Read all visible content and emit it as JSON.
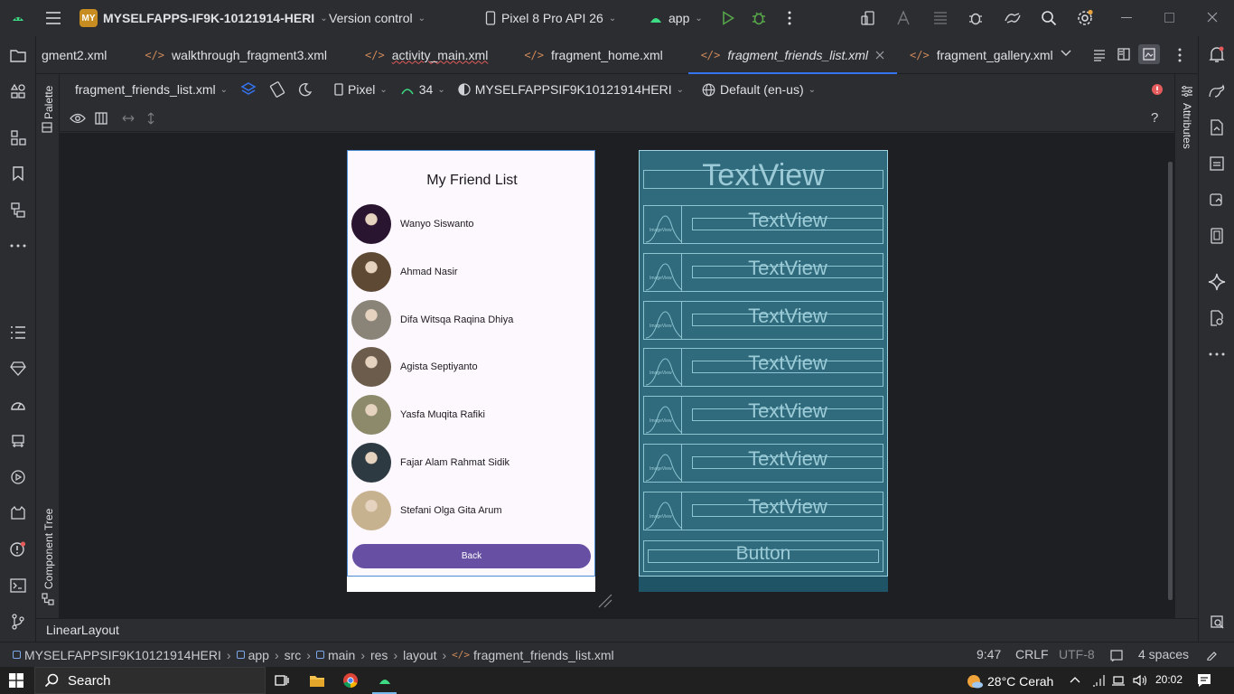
{
  "titlebar": {
    "project_badge": "MY",
    "project_name": "MYSELFAPPS-IF9K-10121914-HERI",
    "vcs": "Version control",
    "device": "Pixel 8 Pro API 26",
    "run_config": "app"
  },
  "tabs": [
    {
      "label": "gment2.xml"
    },
    {
      "label": "walkthrough_fragment3.xml"
    },
    {
      "label": "activity_main.xml"
    },
    {
      "label": "fragment_home.xml"
    },
    {
      "label": "fragment_friends_list.xml"
    },
    {
      "label": "fragment_gallery.xml"
    }
  ],
  "designbar": {
    "file": "fragment_friends_list.xml",
    "device": "Pixel",
    "api": "34",
    "theme": "MYSELFAPPSIF9K10121914HERI",
    "locale": "Default (en-us)"
  },
  "side_panels": {
    "palette": "Palette",
    "component_tree": "Component Tree",
    "attributes": "Attributes"
  },
  "phone": {
    "title": "My Friend List",
    "friends": [
      {
        "name": "Wanyo Siswanto",
        "color": "#2a1530"
      },
      {
        "name": "Ahmad Nasir",
        "color": "#5e4a34"
      },
      {
        "name": "Difa Witsqa Raqina Dhiya",
        "color": "#8a8478"
      },
      {
        "name": "Agista Septiyanto",
        "color": "#6b5c4c"
      },
      {
        "name": "Yasfa Muqita Rafiki",
        "color": "#8d8a6c"
      },
      {
        "name": "Fajar Alam Rahmat Sidik",
        "color": "#2e3a42"
      },
      {
        "name": "Stefani Olga Gita Arum",
        "color": "#c7b28f"
      }
    ],
    "back_label": "Back"
  },
  "blueprint": {
    "textview_label": "TextView",
    "imageview_label": "ImageView",
    "button_label": "Button"
  },
  "layout_label": "LinearLayout",
  "statusbar": {
    "breadcrumbs": [
      "MYSELFAPPSIF9K10121914HERI",
      "app",
      "src",
      "main",
      "res",
      "layout",
      "fragment_friends_list.xml"
    ],
    "position": "9:47",
    "line_sep": "CRLF",
    "encoding": "UTF-8",
    "indent": "4 spaces"
  },
  "taskbar": {
    "search": "Search",
    "weather": "28°C  Cerah",
    "time": "20:02"
  }
}
